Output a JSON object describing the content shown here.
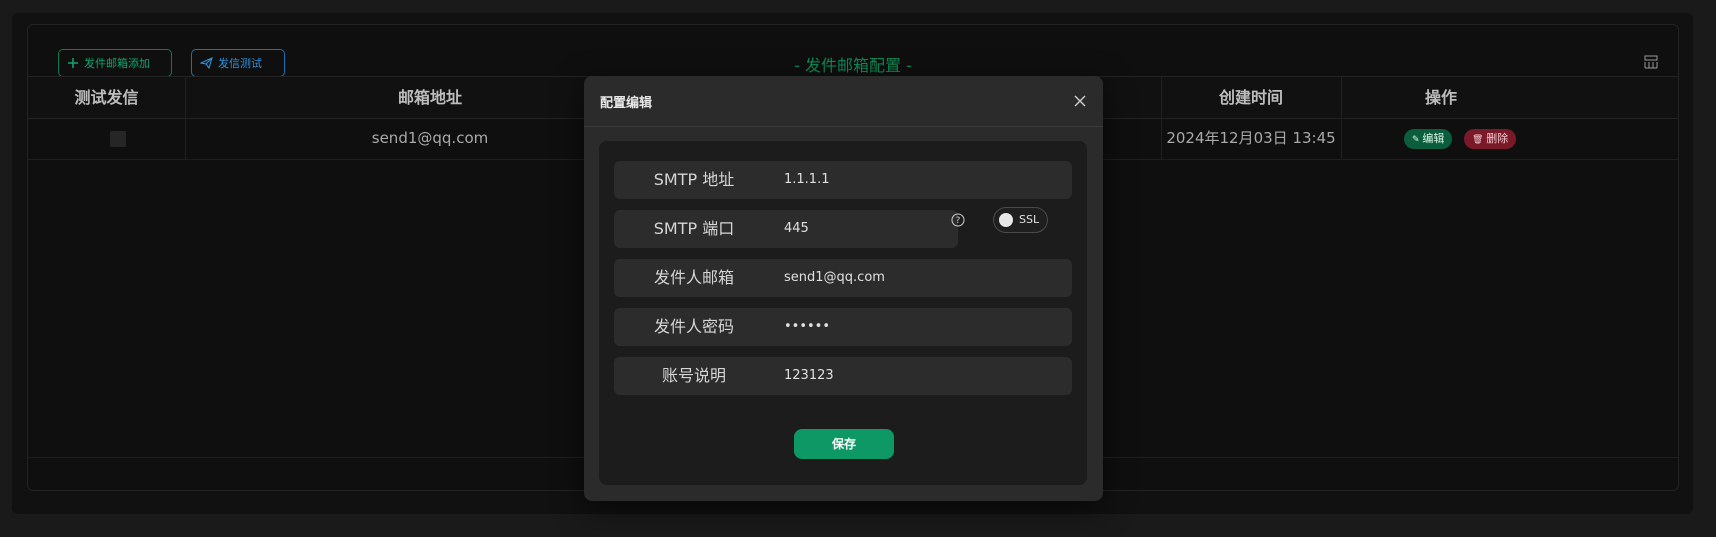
{
  "toolbar": {
    "add_label": "发件邮箱添加",
    "test_label": "发信测试",
    "title": "- 发件邮箱配置 -"
  },
  "table": {
    "columns": [
      "测试发信",
      "邮箱地址",
      "创建时间",
      "操作"
    ],
    "rows": [
      {
        "email": "send1@qq.com",
        "created": "2024年12月03日 13:45",
        "edit": "编辑",
        "delete": "删除"
      }
    ]
  },
  "modal": {
    "title": "配置编辑",
    "fields": [
      {
        "label": "SMTP 地址",
        "value": "1.1.1.1"
      },
      {
        "label": "SMTP 端口",
        "value": "445"
      },
      {
        "label": "发件人邮箱",
        "value": "send1@qq.com"
      },
      {
        "label": "发件人密码",
        "value": "••••••"
      },
      {
        "label": "账号说明",
        "value": "123123"
      }
    ],
    "ssl_label": "SSL",
    "ssl_on": false,
    "save_label": "保存"
  },
  "colors": {
    "accent_green": "#0e9865",
    "accent_blue": "#3092de",
    "danger": "#7a1a28"
  },
  "icons": [
    "plus-icon",
    "send-icon",
    "grid-settings-icon",
    "close-icon",
    "help-icon",
    "pencil-icon",
    "trash-icon"
  ]
}
